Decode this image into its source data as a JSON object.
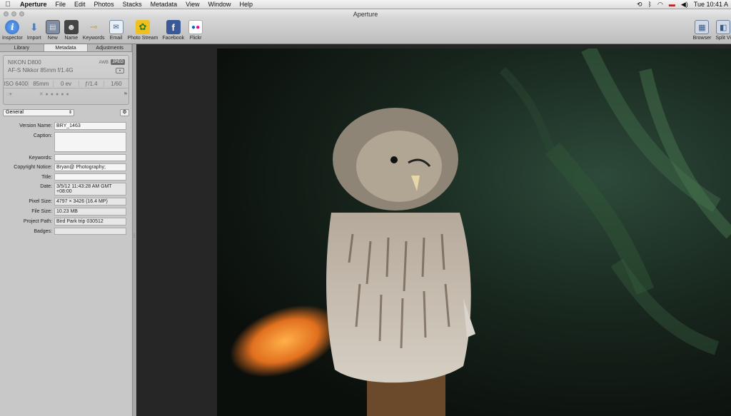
{
  "menubar": {
    "apple": "",
    "items": [
      "Aperture",
      "File",
      "Edit",
      "Photos",
      "Stacks",
      "Metadata",
      "View",
      "Window",
      "Help"
    ],
    "clock": "Tue 10:41 A"
  },
  "window": {
    "title": "Aperture"
  },
  "toolbar": {
    "left": [
      {
        "label": "Inspector",
        "icon": "info-icon"
      },
      {
        "label": "Import",
        "icon": "import-arrow-icon"
      },
      {
        "label": "New",
        "icon": "new-icon"
      },
      {
        "label": "Name",
        "icon": "name-icon"
      },
      {
        "label": "Keywords",
        "icon": "keywords-tag-icon"
      },
      {
        "label": "Email",
        "icon": "email-icon"
      },
      {
        "label": "Photo Stream",
        "icon": "photo-stream-icon"
      },
      {
        "label": "Facebook",
        "icon": "facebook-icon"
      },
      {
        "label": "Flickr",
        "icon": "flickr-icon"
      }
    ],
    "right": [
      {
        "label": "Browser",
        "icon": "browser-grid-icon"
      },
      {
        "label": "Split Vi",
        "icon": "split-view-icon"
      }
    ]
  },
  "inspector": {
    "tabs": [
      "Library",
      "Metadata",
      "Adjustments"
    ],
    "active_tab": "Metadata",
    "camera": {
      "model": "NIKON D800",
      "lens": "AF-S Nikkor 85mm f/1.4G",
      "awb": "AWB",
      "format": "JPEG",
      "iso": "ISO 6400",
      "focal": "85mm",
      "ev": "0 ev",
      "aperture": "ƒ/1.4",
      "shutter": "1/60"
    },
    "preset": "General",
    "fields": [
      {
        "label": "Version Name:",
        "value": "BRY_1463"
      },
      {
        "label": "Caption:",
        "value": ""
      },
      {
        "label": "Keywords:",
        "value": ""
      },
      {
        "label": "Copyright Notice:",
        "value": "Bryan@ Photography;"
      },
      {
        "label": "Title:",
        "value": ""
      },
      {
        "label": "Date:",
        "value": "3/5/12 11:43:28 AM GMT +08:00"
      },
      {
        "label": "Pixel Size:",
        "value": "4797 × 3426 (16.4 MP)"
      },
      {
        "label": "File Size:",
        "value": "10.23 MB"
      },
      {
        "label": "Project Path:",
        "value": "Bird Park trip 030512"
      },
      {
        "label": "Badges:",
        "value": ""
      }
    ]
  },
  "colors": {
    "toolbar": "#c8c8c8",
    "panel": "#c8c8c8",
    "viewer": "#262626"
  }
}
